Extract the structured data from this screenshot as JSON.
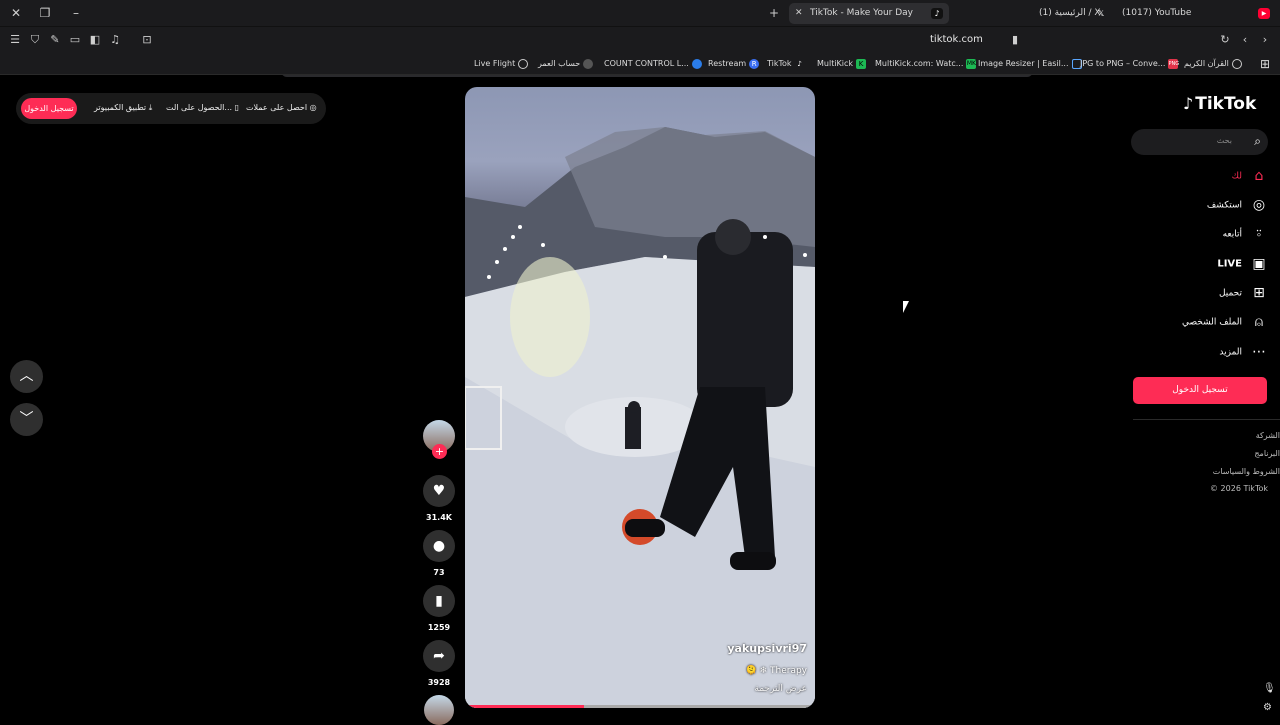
{
  "browser": {
    "tabs": [
      {
        "label": "TikTok - Make Your Day",
        "active": true
      },
      {
        "label": "(1) الرئيسية / X",
        "active": false
      },
      {
        "label": "(1017) YouTube",
        "active": false
      }
    ],
    "url": "tiktok.com",
    "bookmarks": [
      {
        "label": "Live Flight"
      },
      {
        "label": "حساب العمر"
      },
      {
        "label": "COUNT CONTROL L..."
      },
      {
        "label": "Restream"
      },
      {
        "label": "TikTok"
      },
      {
        "label": "MultiKick"
      },
      {
        "label": "MultiKick.com: Watc..."
      },
      {
        "label": "Image Resizer | Easil..."
      },
      {
        "label": "JPG to PNG – Conve..."
      },
      {
        "label": "القرآن الكريم"
      }
    ]
  },
  "topbar": {
    "login_label": "تسجيل الدخول",
    "desktop_app_label": "تطبيق الكمبيوتر",
    "get_app_label": "الحصول على الت...",
    "coins_label": "احصل على عملات"
  },
  "video": {
    "username": "yakupsivri97",
    "caption": "Therapy",
    "translate_label": "عرض الترجمة",
    "progress": 0.34
  },
  "actions": {
    "likes": "31.4K",
    "comments": "73",
    "saves": "1259",
    "shares": "3928"
  },
  "sidebar": {
    "logo": "TikTok",
    "search_placeholder": "بحث",
    "nav": [
      {
        "label": "لك",
        "icon": "home-icon",
        "active": true
      },
      {
        "label": "استكشف",
        "icon": "compass-icon"
      },
      {
        "label": "أتابعه",
        "icon": "follow-user-icon"
      },
      {
        "label": "LIVE",
        "icon": "live-tv-icon"
      },
      {
        "label": "تحميل",
        "icon": "upload-plus-icon"
      },
      {
        "label": "الملف الشخصي",
        "icon": "profile-icon"
      },
      {
        "label": "المزيد",
        "icon": "more-dots-icon"
      }
    ],
    "login_label": "تسجيل الدخول",
    "footer": [
      "الشركة",
      "البرنامج",
      "الشروط والسياسات",
      "© 2026 TikTok"
    ]
  },
  "colors": {
    "accent": "#fe2c55",
    "background": "#000000"
  }
}
